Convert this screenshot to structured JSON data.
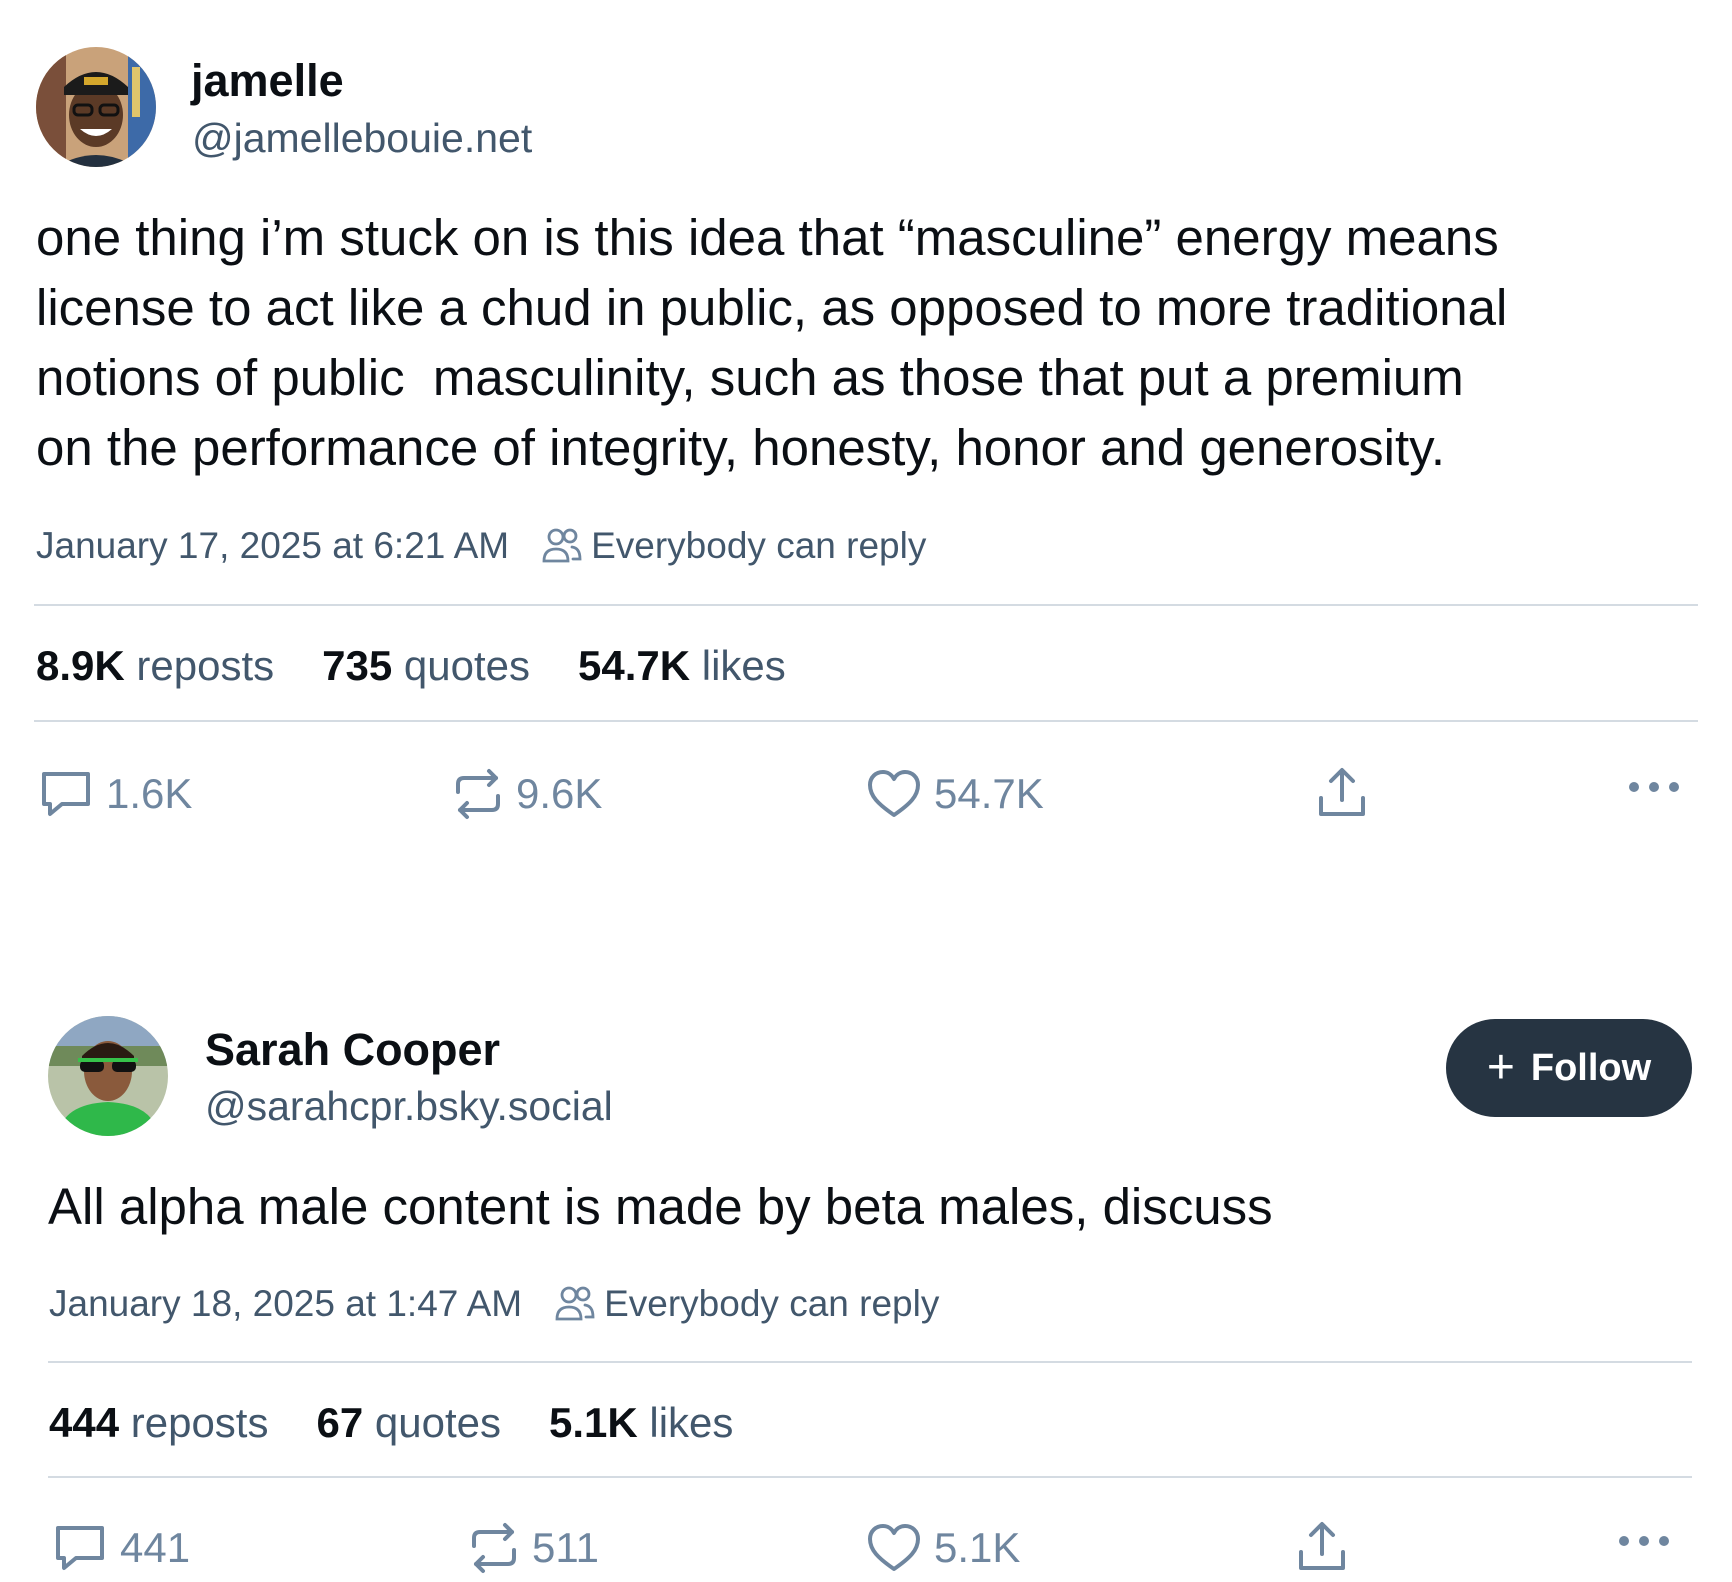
{
  "posts": [
    {
      "display_name": "jamelle",
      "handle": "@jamellebouie.net",
      "text": "one thing i’m stuck on is this idea that “masculine” energy means\nlicense to act like a chud in public, as opposed to more traditional\nnotions of public  masculinity, such as those that put a premium\non the performance of integrity, honesty, honor and generosity.",
      "timestamp": "January 17, 2025 at 6:21 AM",
      "reply_setting": "Everybody can reply",
      "stats": {
        "reposts_count": "8.9K",
        "reposts_label": "reposts",
        "quotes_count": "735",
        "quotes_label": "quotes",
        "likes_count": "54.7K",
        "likes_label": "likes"
      },
      "actions": {
        "replies": "1.6K",
        "reposts": "9.6K",
        "likes": "54.7K"
      }
    },
    {
      "display_name": "Sarah Cooper",
      "handle": "@sarahcpr.bsky.social",
      "follow_label": "Follow",
      "text": "All alpha male content is made by beta males, discuss",
      "timestamp": "January 18, 2025 at 1:47 AM",
      "reply_setting": "Everybody can reply",
      "stats": {
        "reposts_count": "444",
        "reposts_label": "reposts",
        "quotes_count": "67",
        "quotes_label": "quotes",
        "likes_count": "5.1K",
        "likes_label": "likes"
      },
      "actions": {
        "replies": "441",
        "reposts": "511",
        "likes": "5.1K"
      }
    }
  ],
  "icons": {
    "reply": "speech-bubble-icon",
    "repost": "repost-arrows-icon",
    "like": "heart-icon",
    "share": "share-upload-icon",
    "more": "ellipsis-icon",
    "reply_setting": "people-icon"
  },
  "colors": {
    "text": "#0b0f14",
    "muted": "#42576c",
    "icon": "#6f869f",
    "divider": "#d4dbe2",
    "follow_button": "#263442"
  }
}
